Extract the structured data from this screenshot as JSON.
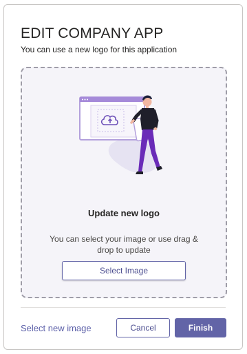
{
  "dialog": {
    "title": "EDIT COMPANY APP",
    "subtitle": "You can use a new logo for this application"
  },
  "dropzone": {
    "heading": "Update new logo",
    "description": "You can select your image or use drag & drop to update",
    "select_button": "Select Image"
  },
  "footer": {
    "link": "Select new image",
    "cancel": "Cancel",
    "finish": "Finish"
  },
  "colors": {
    "accent": "#6264a7",
    "dropzone_bg": "#f5f4f9",
    "dropzone_border": "#9f9da8"
  },
  "icons": {
    "illustration": "person-uploading-to-cloud-illustration",
    "upload": "cloud-upload-icon"
  }
}
